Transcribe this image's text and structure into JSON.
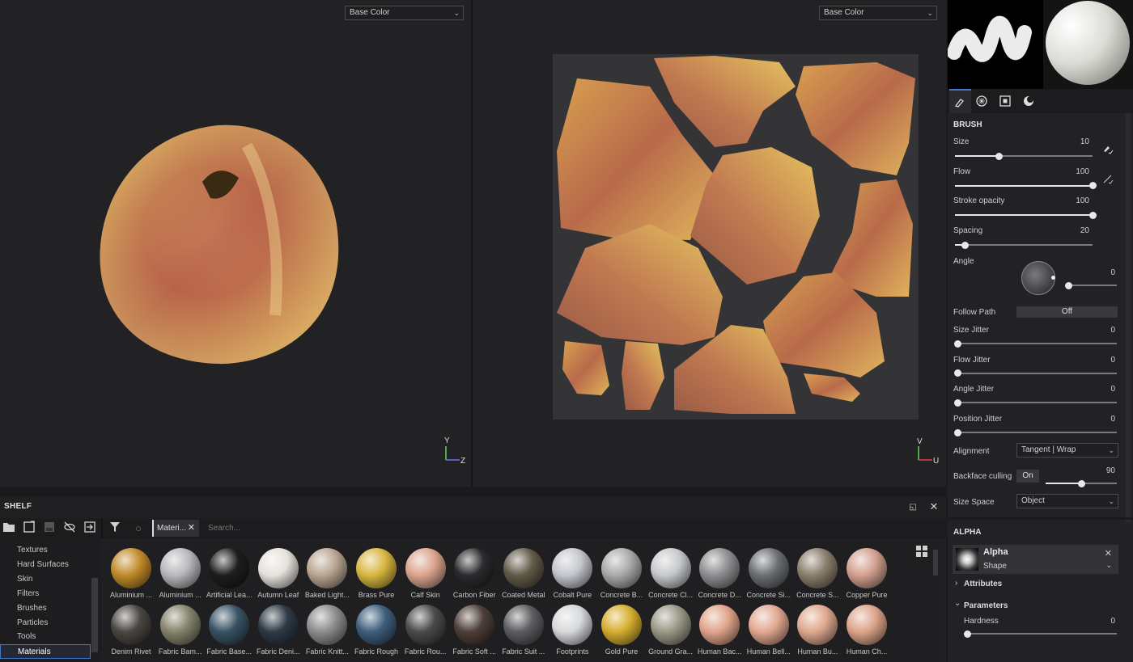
{
  "viewports": {
    "left": {
      "channel": "Base Color",
      "axis_y": "Y",
      "axis_x": "Z"
    },
    "right": {
      "channel": "Base Color",
      "axis_y": "V",
      "axis_x": "U"
    }
  },
  "shelf": {
    "title": "SHELF",
    "filter_tab": "Materi...",
    "search_placeholder": "Search...",
    "categories": [
      "Textures",
      "Hard Surfaces",
      "Skin",
      "Filters",
      "Brushes",
      "Particles",
      "Tools",
      "Materials"
    ],
    "selected_category": "Materials",
    "row1": [
      {
        "label": "Aluminium ...",
        "color": "#c08a2a"
      },
      {
        "label": "Aluminium ...",
        "color": "#b8b8bc"
      },
      {
        "label": "Artificial Lea...",
        "color": "#1e1e20"
      },
      {
        "label": "Autumn Leaf",
        "color": "#e6e2dc"
      },
      {
        "label": "Baked Light...",
        "color": "#b8a592"
      },
      {
        "label": "Brass Pure",
        "color": "#d7b640"
      },
      {
        "label": "Calf Skin",
        "color": "#dba48e"
      },
      {
        "label": "Carbon Fiber",
        "color": "#2b2b2e"
      },
      {
        "label": "Coated Metal",
        "color": "#625a48"
      },
      {
        "label": "Cobalt Pure",
        "color": "#c3c6cc"
      },
      {
        "label": "Concrete B...",
        "color": "#a9a9a9"
      },
      {
        "label": "Concrete Cl...",
        "color": "#c6c8ca"
      },
      {
        "label": "Concrete D...",
        "color": "#8d8e90"
      },
      {
        "label": "Concrete Si...",
        "color": "#6b6e72"
      },
      {
        "label": "Concrete S...",
        "color": "#8a7e6c"
      },
      {
        "label": "Copper Pure",
        "color": "#d2a08e"
      }
    ],
    "row2": [
      {
        "label": "Denim Rivet",
        "color": "#4a4642"
      },
      {
        "label": "Fabric Bam...",
        "color": "#85836c"
      },
      {
        "label": "Fabric Base...",
        "color": "#385264"
      },
      {
        "label": "Fabric Deni...",
        "color": "#2e3a46"
      },
      {
        "label": "Fabric Knitt...",
        "color": "#8c8c8e"
      },
      {
        "label": "Fabric Rough",
        "color": "#3e5e7c"
      },
      {
        "label": "Fabric Rou...",
        "color": "#4a4a4c"
      },
      {
        "label": "Fabric Soft ...",
        "color": "#4e3e38"
      },
      {
        "label": "Fabric Suit ...",
        "color": "#5a5c5e"
      },
      {
        "label": "Footprints",
        "color": "#d6d8da"
      },
      {
        "label": "Gold Pure",
        "color": "#d6ae30"
      },
      {
        "label": "Ground Gra...",
        "color": "#9a9886"
      },
      {
        "label": "Human Bac...",
        "color": "#e0a48a"
      },
      {
        "label": "Human Bell...",
        "color": "#e2a890"
      },
      {
        "label": "Human Bu...",
        "color": "#dea88e"
      },
      {
        "label": "Human Ch...",
        "color": "#dca48a"
      }
    ]
  },
  "panel": {
    "brush_header": "BRUSH",
    "sliders": [
      {
        "label": "Size",
        "value": "10",
        "frac": 0.3
      },
      {
        "label": "Flow",
        "value": "100",
        "frac": 1.0
      },
      {
        "label": "Stroke opacity",
        "value": "100",
        "frac": 1.0
      },
      {
        "label": "Spacing",
        "value": "20",
        "frac": 0.05
      }
    ],
    "angle": {
      "label": "Angle",
      "value": "0"
    },
    "follow_path": {
      "label": "Follow Path",
      "value": "Off"
    },
    "jitters": [
      {
        "label": "Size Jitter",
        "value": "0"
      },
      {
        "label": "Flow Jitter",
        "value": "0"
      },
      {
        "label": "Angle Jitter",
        "value": "0"
      },
      {
        "label": "Position Jitter",
        "value": "0"
      }
    ],
    "alignment": {
      "label": "Alignment",
      "value": "Tangent | Wrap"
    },
    "backface": {
      "label": "Backface culling",
      "toggle": "On",
      "value": "90",
      "frac": 0.5
    },
    "size_space": {
      "label": "Size Space",
      "value": "Object"
    },
    "alpha_header": "ALPHA",
    "alpha": {
      "name": "Alpha",
      "type": "Shape"
    },
    "attributes": "Attributes",
    "parameters": "Parameters",
    "hardness": {
      "label": "Hardness",
      "value": "0"
    }
  }
}
